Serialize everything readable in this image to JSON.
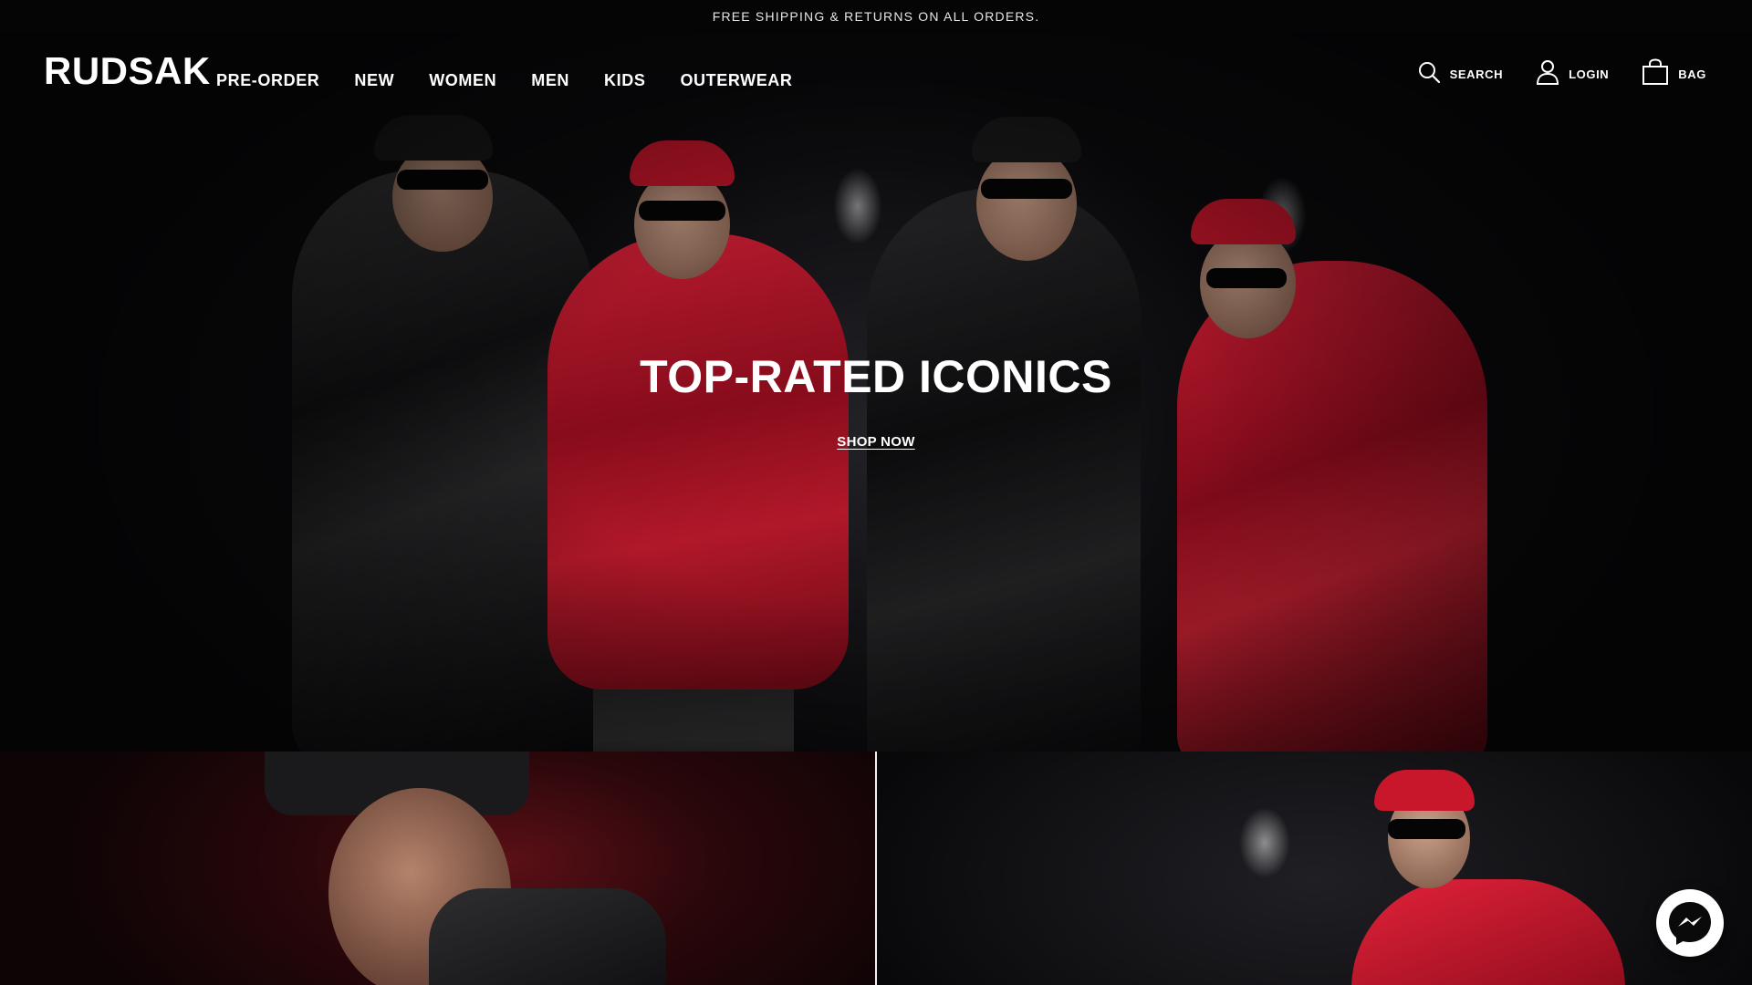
{
  "announcement": {
    "text": "FREE SHIPPING & RETURNS ON ALL ORDERS."
  },
  "brand": {
    "logo": "RUDSAK"
  },
  "nav": {
    "items": [
      {
        "label": "PRE-ORDER"
      },
      {
        "label": "NEW"
      },
      {
        "label": "WOMEN"
      },
      {
        "label": "MEN"
      },
      {
        "label": "KIDS"
      },
      {
        "label": "OUTERWEAR"
      }
    ]
  },
  "utilities": {
    "search_label": "SEARCH",
    "login_label": "LOGIN",
    "bag_label": "BAG",
    "search_icon": "search-icon",
    "login_icon": "user-icon",
    "bag_icon": "shopping-bag-icon"
  },
  "hero": {
    "title": "TOP-RATED ICONICS",
    "cta": "SHOP NOW"
  },
  "chat": {
    "icon": "messenger-icon"
  },
  "colors": {
    "accent_red": "#d81e33",
    "background": "#0b0a0c",
    "text": "#ffffff"
  }
}
